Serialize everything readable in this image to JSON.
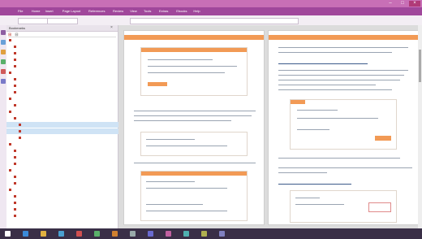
{
  "window": {
    "title": "",
    "controls": [
      "minimize-icon",
      "maximize-icon",
      "close-icon"
    ]
  },
  "menu": {
    "items": [
      "File",
      "Home",
      "Insert",
      "Page Layout",
      "References",
      "Review",
      "View",
      "Tools",
      "Extras",
      "Ebooks",
      "Help"
    ]
  },
  "toolbar": {
    "buttons": [
      "",
      "",
      ""
    ]
  },
  "panel": {
    "title": "Bookmarks"
  },
  "tree": {
    "rows": [
      {
        "label": "",
        "level": 0
      },
      {
        "label": "",
        "level": 1
      },
      {
        "label": "",
        "level": 1
      },
      {
        "label": "",
        "level": 1
      },
      {
        "label": "",
        "level": 1
      },
      {
        "label": "",
        "level": 0
      },
      {
        "label": "",
        "level": 1
      },
      {
        "label": "",
        "level": 1
      },
      {
        "label": "",
        "level": 1
      },
      {
        "label": "",
        "level": 0
      },
      {
        "label": "",
        "level": 1
      },
      {
        "label": "",
        "level": 0
      },
      {
        "label": "",
        "level": 1
      },
      {
        "label": "",
        "level": 2
      },
      {
        "label": "",
        "level": 2
      },
      {
        "label": "",
        "level": 2
      },
      {
        "label": "",
        "level": 0
      },
      {
        "label": "",
        "level": 1
      },
      {
        "label": "",
        "level": 1
      },
      {
        "label": "",
        "level": 1
      },
      {
        "label": "",
        "level": 0
      },
      {
        "label": "",
        "level": 1
      },
      {
        "label": "",
        "level": 1
      },
      {
        "label": "",
        "level": 0
      },
      {
        "label": "",
        "level": 1
      },
      {
        "label": "",
        "level": 1
      },
      {
        "label": "",
        "level": 1
      },
      {
        "label": "",
        "level": 1
      }
    ]
  },
  "colors": {
    "accent": "#a0479b",
    "orange": "#f29a55",
    "taskbar": "#3a2f47"
  },
  "taskbar": {
    "icons": [
      "start-icon",
      "browser-icon",
      "folder-icon",
      "mail-icon",
      "media-icon",
      "store-icon",
      "photos-icon",
      "settings-icon",
      "app-icon-1",
      "app-icon-2",
      "app-icon-3",
      "app-icon-4",
      "app-icon-5"
    ]
  }
}
